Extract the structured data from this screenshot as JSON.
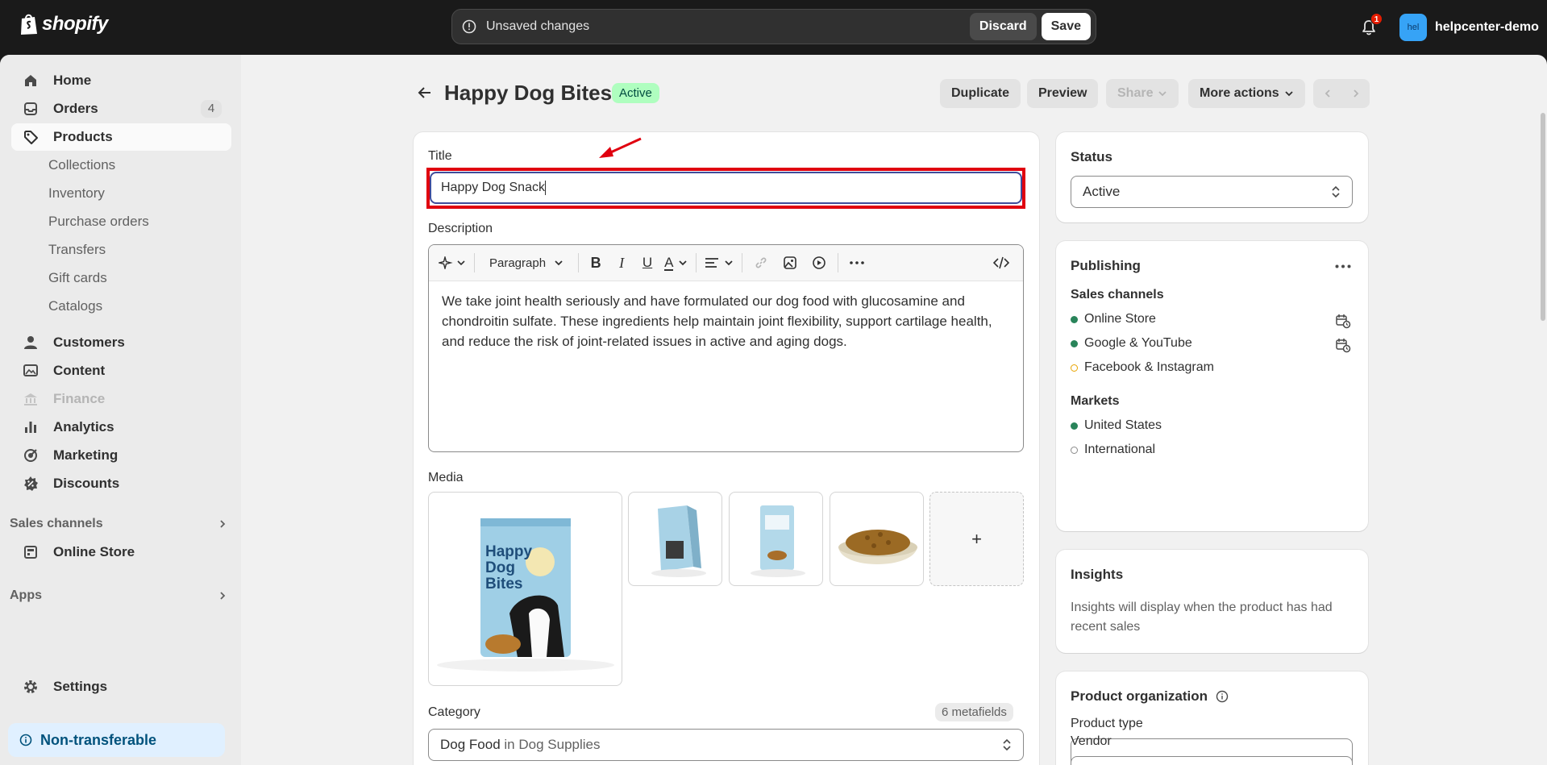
{
  "topbar": {
    "logo_text": "shopify",
    "unsaved_text": "Unsaved changes",
    "discard_label": "Discard",
    "save_label": "Save",
    "notification_count": "1",
    "avatar_text": "hel",
    "store_name": "helpcenter-demo"
  },
  "sidebar": {
    "items": [
      {
        "label": "Home",
        "icon": "home-icon"
      },
      {
        "label": "Orders",
        "icon": "orders-icon",
        "count": "4"
      },
      {
        "label": "Products",
        "icon": "tag-icon"
      },
      {
        "label": "Customers",
        "icon": "person-icon"
      },
      {
        "label": "Content",
        "icon": "image-icon"
      },
      {
        "label": "Finance",
        "icon": "bank-icon"
      },
      {
        "label": "Analytics",
        "icon": "chart-icon"
      },
      {
        "label": "Marketing",
        "icon": "target-icon"
      },
      {
        "label": "Discounts",
        "icon": "discount-icon"
      }
    ],
    "product_sub": [
      "Collections",
      "Inventory",
      "Purchase orders",
      "Transfers",
      "Gift cards",
      "Catalogs"
    ],
    "sales_channels_label": "Sales channels",
    "online_store_label": "Online Store",
    "apps_label": "Apps",
    "settings_label": "Settings",
    "non_transferable_label": "Non-transferable"
  },
  "header": {
    "title": "Happy Dog Bites",
    "status_badge": "Active",
    "duplicate": "Duplicate",
    "preview": "Preview",
    "share": "Share",
    "more_actions": "More actions"
  },
  "product": {
    "title_label": "Title",
    "title_value": "Happy Dog Snack",
    "description_label": "Description",
    "paragraph_label": "Paragraph",
    "description_text": "We take joint health seriously and have formulated our dog food with glucosamine and chondroitin sulfate. These ingredients help maintain joint flexibility, support cartilage health, and reduce the risk of joint-related issues in active and aging dogs.",
    "media_label": "Media",
    "media_add": "+",
    "media_package_lines": [
      "Happy",
      "Dog",
      "Bites"
    ],
    "category_label": "Category",
    "metafields_badge": "6 metafields",
    "category_value": "Dog Food",
    "category_in": "in",
    "category_parent": "Dog Supplies"
  },
  "status_card": {
    "title": "Status",
    "value": "Active"
  },
  "publishing": {
    "title": "Publishing",
    "sales_channels_label": "Sales channels",
    "channels": [
      {
        "name": "Online Store",
        "color": "#29845a"
      },
      {
        "name": "Google & YouTube",
        "color": "#29845a"
      },
      {
        "name": "Facebook & Instagram",
        "color": "#e8a400"
      }
    ],
    "markets_label": "Markets",
    "markets": [
      {
        "name": "United States",
        "color": "#29845a"
      },
      {
        "name": "International",
        "color": "#8a8a8a"
      }
    ]
  },
  "insights": {
    "title": "Insights",
    "text": "Insights will display when the product has had recent sales"
  },
  "organization": {
    "title": "Product organization",
    "type_label": "Product type",
    "vendor_label": "Vendor"
  }
}
